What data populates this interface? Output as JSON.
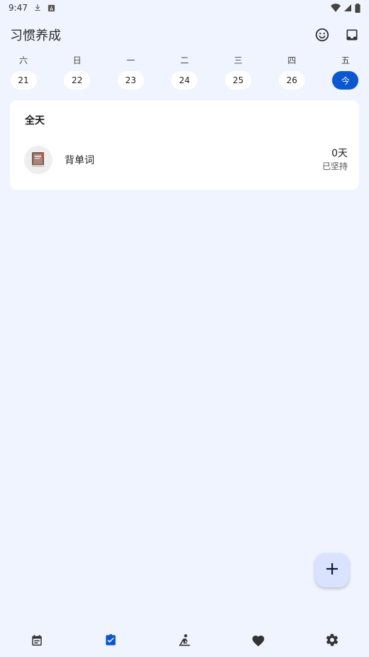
{
  "status_bar": {
    "time": "9:47"
  },
  "app_bar": {
    "title": "习惯养成",
    "actions": [
      "emoji-icon",
      "inbox-icon"
    ]
  },
  "week": [
    {
      "name": "六",
      "date": "21",
      "today": false
    },
    {
      "name": "日",
      "date": "22",
      "today": false
    },
    {
      "name": "一",
      "date": "23",
      "today": false
    },
    {
      "name": "二",
      "date": "24",
      "today": false
    },
    {
      "name": "三",
      "date": "25",
      "today": false
    },
    {
      "name": "四",
      "date": "26",
      "today": false
    },
    {
      "name": "五",
      "date": "今",
      "today": true
    }
  ],
  "section": {
    "title": "全天",
    "habits": [
      {
        "name": "背单词",
        "icon": "book-icon",
        "days": "0天",
        "days_label": "已坚持"
      }
    ]
  },
  "fab": {
    "icon": "plus-icon"
  },
  "bottom_nav": {
    "items": [
      {
        "icon": "calendar-icon",
        "active": false
      },
      {
        "icon": "assignment-check-icon",
        "active": true
      },
      {
        "icon": "meditation-icon",
        "active": false
      },
      {
        "icon": "heart-icon",
        "active": false
      },
      {
        "icon": "settings-icon",
        "active": false
      }
    ]
  },
  "colors": {
    "background": "#f0f4fe",
    "accent": "#0b57d0",
    "fab": "#d9e2ff",
    "card": "#ffffff"
  }
}
